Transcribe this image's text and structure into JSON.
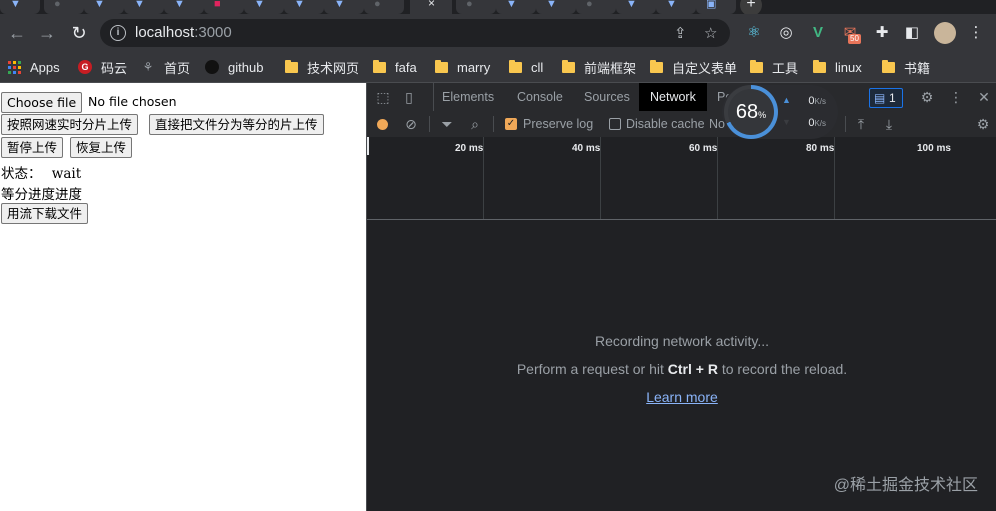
{
  "browser": {
    "url_host": "localhost",
    "url_port": ":3000",
    "extension_badge": "50",
    "bookmarks": [
      {
        "label": "Apps",
        "icon": "apps-grid-icon"
      },
      {
        "label": "码云",
        "icon": "gitee-icon"
      },
      {
        "label": "首页",
        "icon": "site-icon"
      },
      {
        "label": "github",
        "icon": "github-icon"
      },
      {
        "label": "技术网页",
        "icon": "folder-icon"
      },
      {
        "label": "fafa",
        "icon": "folder-icon"
      },
      {
        "label": "marry",
        "icon": "folder-icon"
      },
      {
        "label": "cll",
        "icon": "folder-icon"
      },
      {
        "label": "前端框架",
        "icon": "folder-icon"
      },
      {
        "label": "自定义表单",
        "icon": "folder-icon"
      },
      {
        "label": "工具",
        "icon": "folder-icon"
      },
      {
        "label": "linux",
        "icon": "folder-icon"
      },
      {
        "label": "书籍",
        "icon": "folder-icon"
      }
    ]
  },
  "page": {
    "choose_file_label": "Choose file",
    "no_file_text": "No file chosen",
    "upload_by_speed_label": "按照网速实时分片上传",
    "upload_equal_label": "直接把文件分为等分的片上传",
    "pause_label": "暂停上传",
    "resume_label": "恢复上传",
    "status_label": "状态：",
    "status_value": "wait",
    "progress_text": "等分进度进度",
    "stream_download_label": "用流下载文件"
  },
  "devtools": {
    "tabs": [
      "Elements",
      "Console",
      "Sources",
      "Network",
      "Perf"
    ],
    "active_tab": "Network",
    "issues_count": "1",
    "preserve_log_label": "Preserve log",
    "preserve_log_checked": true,
    "disable_cache_label": "Disable cache",
    "disable_cache_checked": false,
    "throttle_label": "No",
    "timeline_ticks": [
      "20 ms",
      "40 ms",
      "60 ms",
      "80 ms",
      "100 ms"
    ],
    "empty_title": "Recording network activity...",
    "empty_hint_prefix": "Perform a request or hit ",
    "empty_hint_keys": "Ctrl + R",
    "empty_hint_suffix": " to record the reload.",
    "learn_more": "Learn more"
  },
  "speed_widget": {
    "percent": 68,
    "percent_sign": "%",
    "upload": "0",
    "download": "0",
    "unit": "K/s"
  },
  "watermark": "@稀土掘金技术社区"
}
